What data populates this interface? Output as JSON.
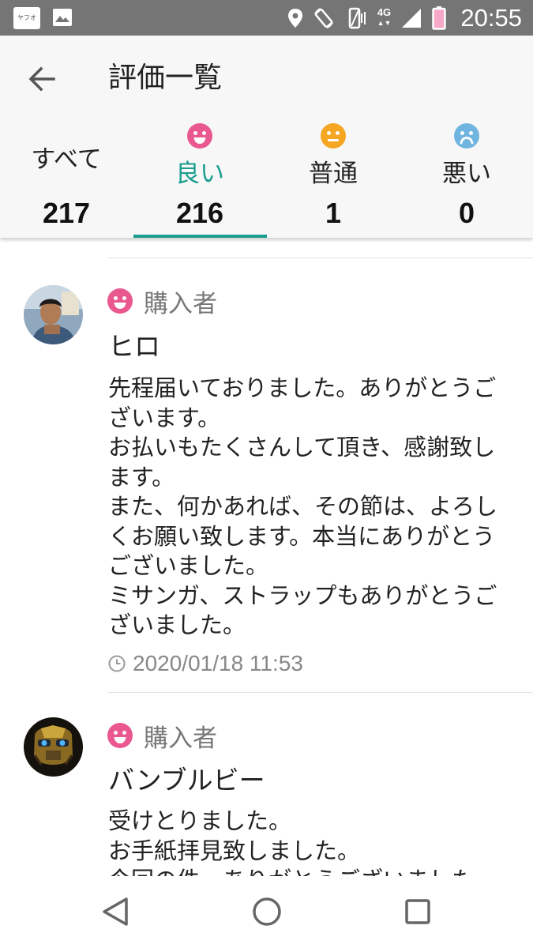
{
  "status_bar": {
    "app_icon_text": "ヤフオク!",
    "time": "20:55",
    "network": "4G"
  },
  "header": {
    "title": "評価一覧"
  },
  "tabs": [
    {
      "label": "すべて",
      "count": "217"
    },
    {
      "label": "良い",
      "count": "216",
      "icon": "smile-face-icon",
      "color": "#e9588f"
    },
    {
      "label": "普通",
      "count": "1",
      "icon": "neutral-face-icon",
      "color": "#f5a623"
    },
    {
      "label": "悪い",
      "count": "0",
      "icon": "sad-face-icon",
      "color": "#6fb5e0"
    }
  ],
  "active_tab": "良い",
  "reviews": [
    {
      "role": "購入者",
      "name": "ヒロ",
      "comment": "先程届いておりました。ありがとうございます。\nお払いもたくさんして頂き、感謝致します。\nまた、何かあれば、その節は、よろしくお願い致します。本当にありがとうございました。\nミサンガ、ストラップもありがとうございました。",
      "date": "2020/01/18 11:53"
    },
    {
      "role": "購入者",
      "name": "バンブルビー",
      "comment": "受けとりました。\nお手紙拝見致しました。\n今回の件、ありがとうございました",
      "date": ""
    }
  ],
  "colors": {
    "accent": "#1a9e8f",
    "good": "#e9588f",
    "neutral": "#f5a623",
    "bad": "#6fb5e0"
  }
}
